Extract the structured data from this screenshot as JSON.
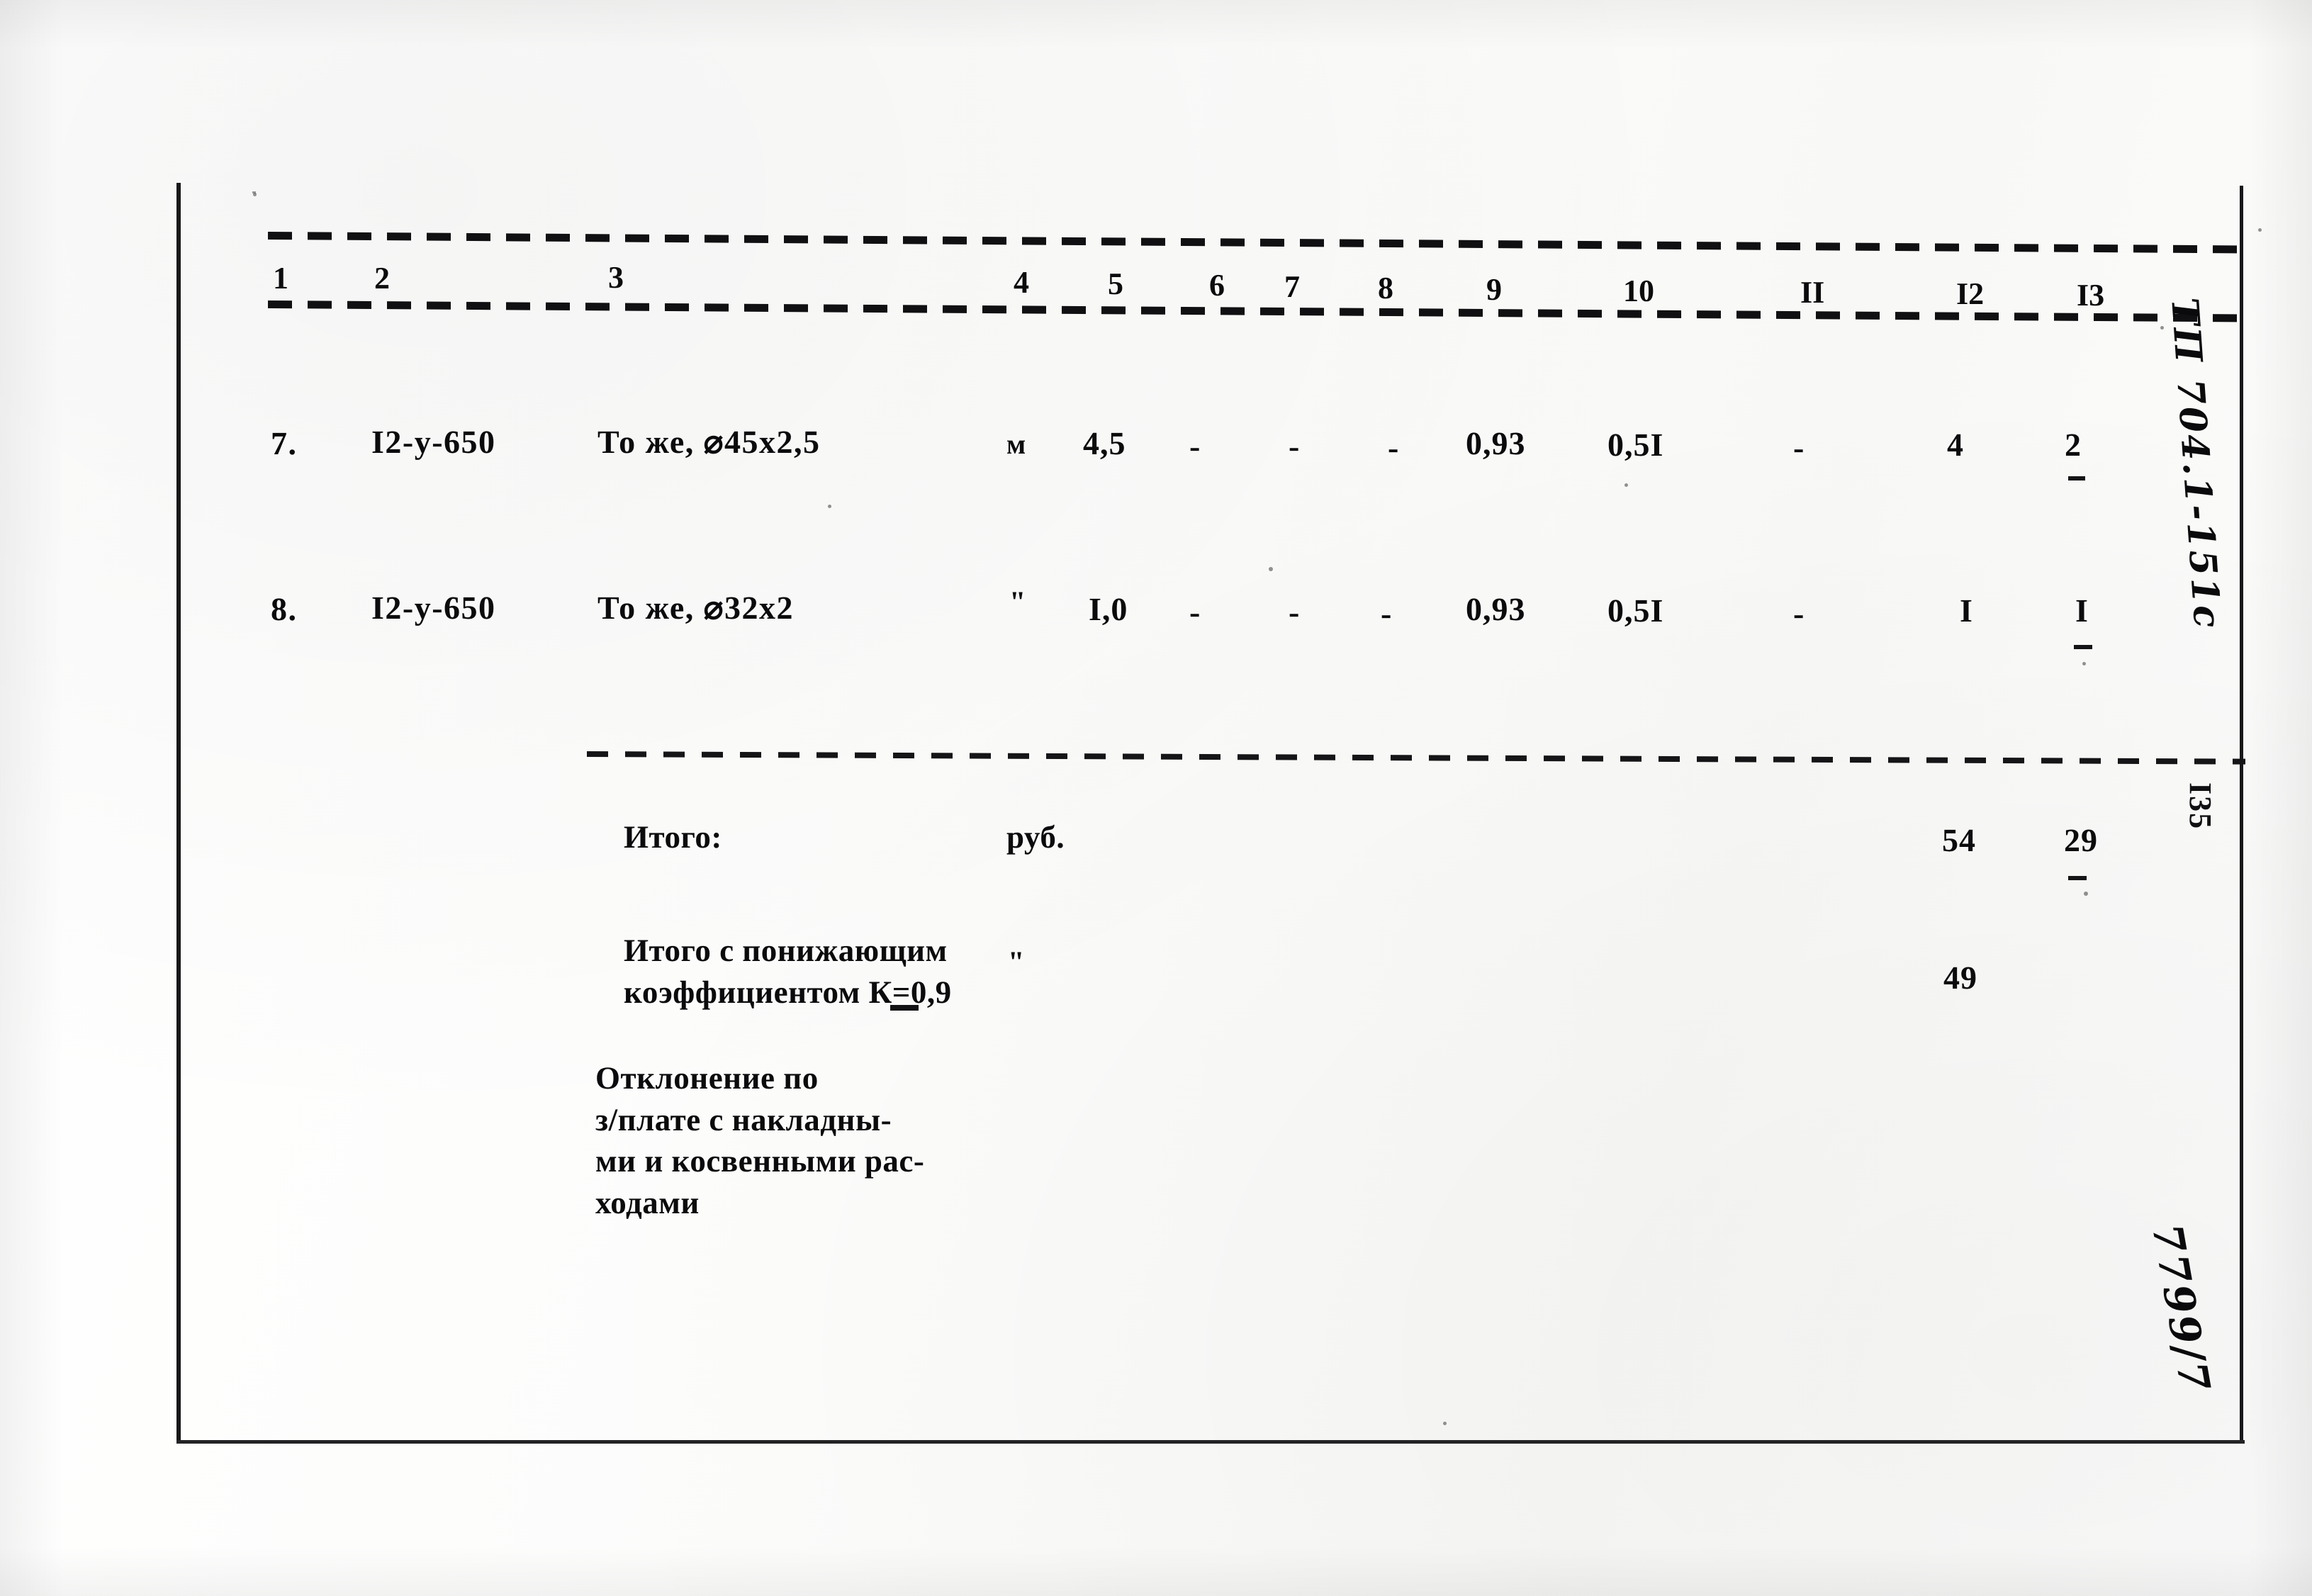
{
  "document": {
    "kind": "scanned-estimate-table",
    "page_number": "I35",
    "margin_code": "ТП 704.1-151с",
    "bottom_code": "7799/7"
  },
  "table": {
    "column_headers": [
      "1",
      "2",
      "3",
      "4",
      "5",
      "6",
      "7",
      "8",
      "9",
      "10",
      "II",
      "I2",
      "I3"
    ],
    "rows": [
      {
        "num": "7.",
        "code": "I2-у-650",
        "name": "То же, ⌀45х2,5",
        "unit": "м",
        "c5": "4,5",
        "c6": "-",
        "c7": "-",
        "c8": "-",
        "c9": "0,93",
        "c10": "0,5I",
        "c11": "-",
        "c12": "4",
        "c13": "2"
      },
      {
        "num": "8.",
        "code": "I2-у-650",
        "name": "То же, ⌀32х2",
        "unit": "\"",
        "c5": "I,0",
        "c6": "-",
        "c7": "-",
        "c8": "-",
        "c9": "0,93",
        "c10": "0,5I",
        "c11": "-",
        "c12": "I",
        "c13": "I"
      }
    ],
    "summary": [
      {
        "label": "Итого:",
        "unit": "руб.",
        "c12": "54",
        "c13": "29"
      },
      {
        "label": "Итого с понижающим\nкоэффициентом К=0,9",
        "unit": "\"",
        "c12": "49",
        "c13": ""
      },
      {
        "label": "Отклонение по\nз/плате с накладны-\nми и косвенными рас-\nходами",
        "unit": "",
        "c12": "",
        "c13": ""
      }
    ]
  }
}
